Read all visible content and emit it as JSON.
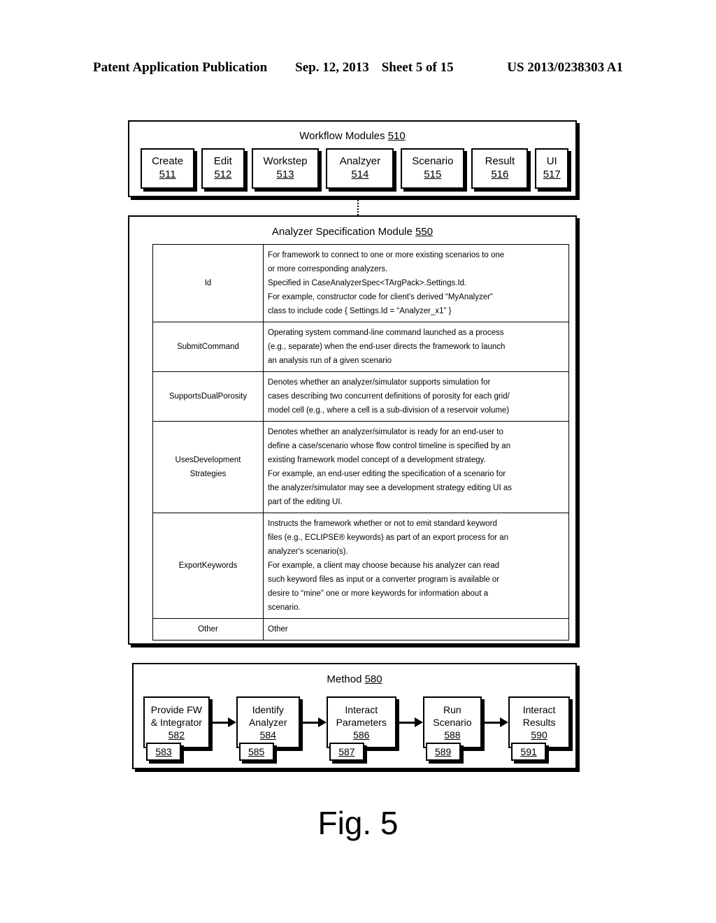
{
  "header": {
    "publication": "Patent Application Publication",
    "date": "Sep. 12, 2013",
    "sheet": "Sheet 5 of 15",
    "pub_number": "US 2013/0238303 A1"
  },
  "workflow": {
    "title_text": "Workflow Modules",
    "title_num": "510",
    "modules": [
      {
        "label": "Create",
        "num": "511"
      },
      {
        "label": "Edit",
        "num": "512"
      },
      {
        "label": "Workstep",
        "num": "513"
      },
      {
        "label": "Analzyer",
        "num": "514"
      },
      {
        "label": "Scenario",
        "num": "515"
      },
      {
        "label": "Result",
        "num": "516"
      },
      {
        "label": "UI",
        "num": "517"
      }
    ]
  },
  "spec_module": {
    "title_text": "Analyzer Specification Module",
    "title_num": "550",
    "rows": [
      {
        "key": "Id",
        "lines": [
          "For framework to connect to one or more existing scenarios to one",
          "or more corresponding analyzers.",
          "Specified in CaseAnalyzerSpec<TArgPack>.Settings.Id.",
          "For example, constructor code for client's derived “MyAnalyzer”",
          "class to include code { Settings.Id = “Analyzer_x1” }"
        ]
      },
      {
        "key": "SubmitCommand",
        "lines": [
          "Operating system command-line command launched as a process",
          "(e.g., separate) when the end-user directs the framework to launch",
          "an analysis run of a given scenario"
        ]
      },
      {
        "key": "SupportsDualPorosity",
        "lines": [
          "Denotes whether an analyzer/simulator supports simulation for",
          "cases describing two concurrent definitions of porosity for each grid/",
          "model cell (e.g., where a cell is a sub-division of a reservoir volume)"
        ]
      },
      {
        "key": "UsesDevelopment Strategies",
        "key_line1": "UsesDevelopment",
        "key_line2": "Strategies",
        "lines": [
          "Denotes whether an analyzer/simulator is ready for an end-user to",
          "define a case/scenario whose flow control timeline is specified by an",
          "existing framework model concept of a development strategy.",
          "For example, an end-user editing the specification of a scenario for",
          "the analyzer/simulator may see a development strategy editing UI as",
          "part of the editing UI."
        ]
      },
      {
        "key": "ExportKeywords",
        "lines": [
          "Instructs the framework whether or not to emit standard keyword",
          "files (e.g., ECLIPSE® keywords) as part of an export process for an",
          "analyzer's scenario(s).",
          "For example, a client may choose because his analyzer can read",
          "such keyword files as input or a converter program is available or",
          "desire to “mine” one or more keywords for information about a",
          "scenario."
        ]
      },
      {
        "key": "Other",
        "lines": [
          "Other"
        ]
      }
    ]
  },
  "method": {
    "title_text": "Method",
    "title_num": "580",
    "steps": [
      {
        "line1": "Provide FW",
        "line2": "& Integrator",
        "num": "582",
        "sub": "583"
      },
      {
        "line1": "Identify",
        "line2": "Analyzer",
        "num": "584",
        "sub": "585"
      },
      {
        "line1": "Interact",
        "line2": "Parameters",
        "num": "586",
        "sub": "587"
      },
      {
        "line1": "Run",
        "line2": "Scenario",
        "num": "588",
        "sub": "589"
      },
      {
        "line1": "Interact",
        "line2": "Results",
        "num": "590",
        "sub": "591"
      }
    ]
  },
  "figure": {
    "caption": "Fig. 5"
  }
}
